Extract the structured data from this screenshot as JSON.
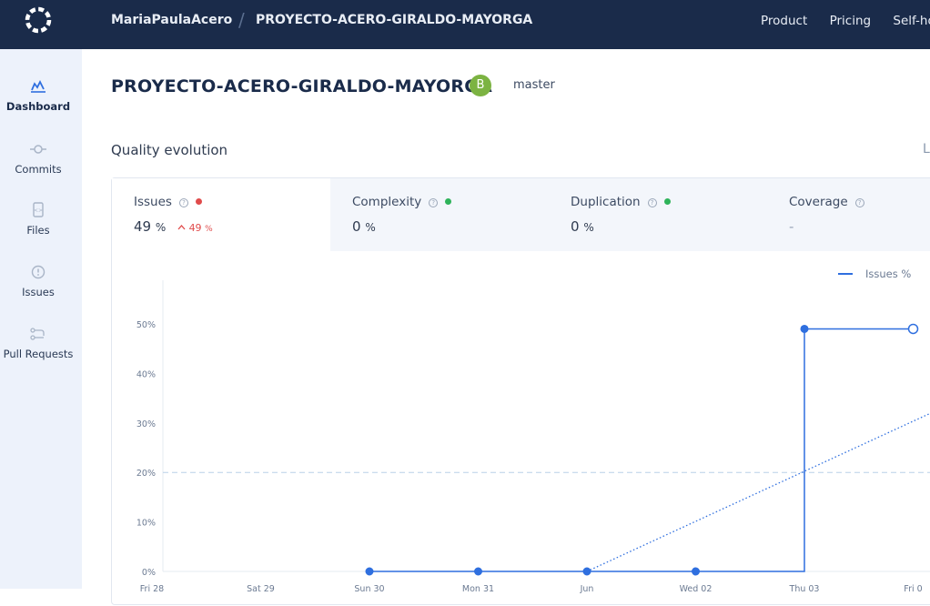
{
  "header": {
    "user": "MariaPaulaAcero",
    "separator": "/",
    "project": "PROYECTO-ACERO-GIRALDO-MAYORGA",
    "nav": [
      "Product",
      "Pricing",
      "Self-ho"
    ]
  },
  "sidebar": {
    "items": [
      {
        "label": "Dashboard",
        "icon": "dashboard-icon",
        "active": true
      },
      {
        "label": "Commits",
        "icon": "commit-icon",
        "active": false
      },
      {
        "label": "Files",
        "icon": "file-icon",
        "active": false
      },
      {
        "label": "Issues",
        "icon": "issues-icon",
        "active": false
      },
      {
        "label": "Pull Requests",
        "icon": "pull-request-icon",
        "active": false
      }
    ]
  },
  "page": {
    "title": "PROYECTO-ACERO-GIRALDO-MAYORGA",
    "grade": "B",
    "branch": "master",
    "section_title": "Quality evolution",
    "section_right": "L"
  },
  "tabs": [
    {
      "label": "Issues",
      "value": "49",
      "unit": "%",
      "delta": "49",
      "delta_unit": "%",
      "status_color": "#e04b4b"
    },
    {
      "label": "Complexity",
      "value": "0",
      "unit": "%",
      "status_color": "#2eb35a"
    },
    {
      "label": "Duplication",
      "value": "0",
      "unit": "%",
      "status_color": "#2eb35a"
    },
    {
      "label": "Coverage",
      "value": "-"
    }
  ],
  "colors": {
    "accent": "#2f6fdf",
    "grade": "#7cb342",
    "header_bg": "#1a2b4a"
  },
  "chart_data": {
    "type": "line",
    "legend": "Issues %",
    "legend_position": "top-right",
    "y_ticks": [
      "0%",
      "10%",
      "20%",
      "30%",
      "40%",
      "50%"
    ],
    "ylim": [
      0,
      55
    ],
    "x_labels": [
      "Fri 28",
      "Sat 29",
      "Sun 30",
      "Mon 31",
      "Jun",
      "Wed 02",
      "Thu 03",
      "Fri 0"
    ],
    "series": [
      {
        "name": "Issues %",
        "points": [
          {
            "x": "Sun 30",
            "y": 0
          },
          {
            "x": "Mon 31",
            "y": 0
          },
          {
            "x": "Jun",
            "y": 0
          },
          {
            "x": "Wed 02",
            "y": 0
          },
          {
            "x": "Thu 03",
            "y": 49
          },
          {
            "x": "Fri 0",
            "y": 49
          }
        ]
      }
    ],
    "trend": {
      "from": {
        "x": "Jun",
        "y": 0
      },
      "to_y_at_right_edge": 32
    },
    "goal_line": 20
  }
}
